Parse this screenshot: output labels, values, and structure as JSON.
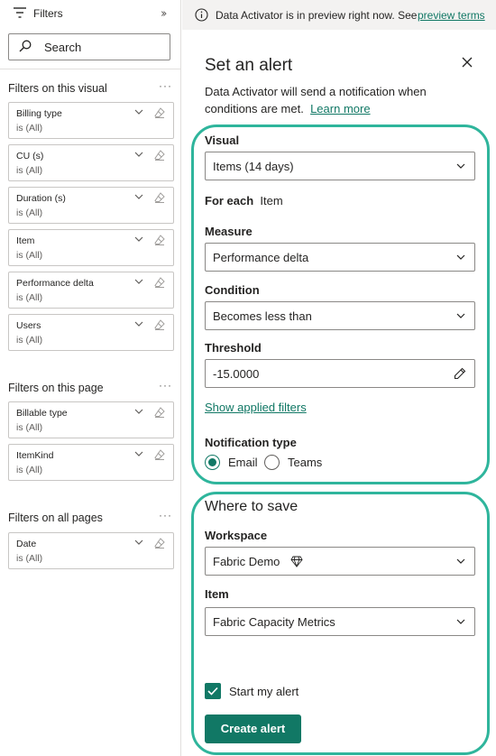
{
  "colors": {
    "accent": "#117865",
    "highlight": "#2fb59c",
    "banner_bg": "#f3f2f1"
  },
  "filters_pane": {
    "title": "Filters",
    "collapse_icon": "double-chevron-right-icon",
    "search": {
      "placeholder": "Search"
    },
    "sections": [
      {
        "title": "Filters on this visual",
        "cards": [
          {
            "name": "Billing type",
            "value": "is (All)"
          },
          {
            "name": "CU (s)",
            "value": "is (All)"
          },
          {
            "name": "Duration (s)",
            "value": "is (All)"
          },
          {
            "name": "Item",
            "value": "is (All)"
          },
          {
            "name": "Performance delta",
            "value": "is (All)"
          },
          {
            "name": "Users",
            "value": "is (All)"
          }
        ]
      },
      {
        "title": "Filters on this page",
        "cards": [
          {
            "name": "Billable type",
            "value": "is (All)"
          },
          {
            "name": "ItemKind",
            "value": "is (All)"
          }
        ]
      },
      {
        "title": "Filters on all pages",
        "cards": [
          {
            "name": "Date",
            "value": "is (All)"
          }
        ]
      }
    ]
  },
  "banner": {
    "text": "Data Activator is in preview right now. See",
    "link": "preview terms"
  },
  "alert": {
    "title": "Set an alert",
    "description": "Data Activator will send a notification when conditions are met.",
    "learn_more": "Learn more",
    "visual_label": "Visual",
    "visual_value": "Items (14 days)",
    "for_each_label": "For each",
    "for_each_value": "Item",
    "measure_label": "Measure",
    "measure_value": "Performance delta",
    "condition_label": "Condition",
    "condition_value": "Becomes less than",
    "threshold_label": "Threshold",
    "threshold_value": "-15.0000",
    "show_filters": "Show applied filters",
    "notification_label": "Notification type",
    "notification_options": [
      "Email",
      "Teams"
    ],
    "notification_selected": "Email",
    "where_to_save": "Where to save",
    "workspace_label": "Workspace",
    "workspace_value": "Fabric Demo",
    "item_label": "Item",
    "item_value": "Fabric Capacity Metrics",
    "start_alert_label": "Start my alert",
    "start_alert_checked": true,
    "create_button": "Create alert"
  }
}
